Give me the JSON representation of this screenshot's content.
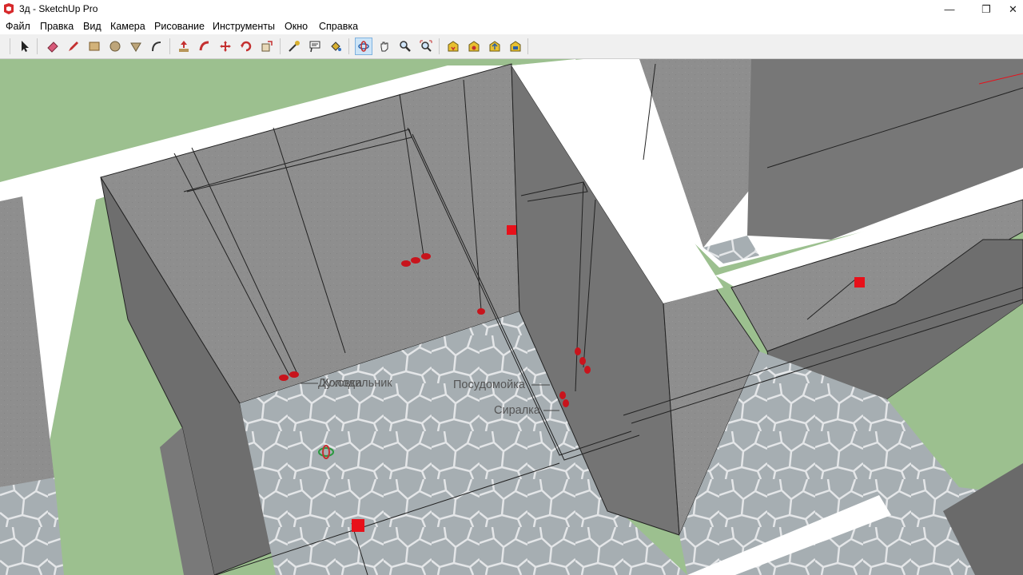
{
  "window": {
    "title": "3д - SketchUp Pro",
    "minimize_glyph": "—",
    "restore_glyph": "❐",
    "close_glyph": "✕"
  },
  "menu": {
    "items": [
      "Файл",
      "Правка",
      "Вид",
      "Камера",
      "Рисование",
      "Инструменты",
      "Окно",
      "Справка"
    ]
  },
  "toolbar": {
    "tools": [
      "select-icon",
      "eraser-icon",
      "pencil-icon",
      "rectangle-icon",
      "circle-icon",
      "polygon-icon",
      "arc-icon",
      "push-pull-icon",
      "follow-me-icon",
      "move-icon",
      "rotate-icon",
      "scale-icon",
      "tape-measure-icon",
      "text-icon",
      "paint-bucket-icon",
      "orbit-icon",
      "pan-icon",
      "zoom-icon",
      "zoom-extents-icon",
      "warehouse-icon",
      "extension-icon",
      "share-model-icon",
      "components-icon"
    ],
    "active_tool": "orbit-icon"
  },
  "colors": {
    "ground": "#9cc08f",
    "wall_top": "#ffffff",
    "wall_side": "#8a8a8a",
    "wall_side_dark": "#6e6e6e",
    "floor": "#a4acb0",
    "marker": "#e8101a",
    "orbit_active": "#cce4f7"
  },
  "viewport": {
    "labels": {
      "label_1": "Духовка",
      "label_2": "Холодильник",
      "dishwasher": "Посудомойка",
      "dryer": "Сиралка"
    }
  }
}
